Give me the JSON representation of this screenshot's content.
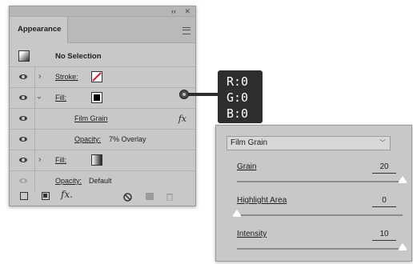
{
  "appearance": {
    "tab_label": "Appearance",
    "rows": {
      "header": {
        "label": "No Selection"
      },
      "stroke": {
        "label": "Stroke:"
      },
      "fill": {
        "label": "Fill:"
      },
      "effect": {
        "label": "Film Grain"
      },
      "effect_opacity": {
        "label": "Opacity:",
        "value": "7% Overlay"
      },
      "fill2": {
        "label": "Fill:"
      },
      "opacity": {
        "label": "Opacity:",
        "value": "Default"
      }
    }
  },
  "color_readout": {
    "r": "R:0",
    "g": "G:0",
    "b": "B:0"
  },
  "film_grain": {
    "effect_select": "Film Grain",
    "params": [
      {
        "label": "Grain",
        "value": "20",
        "fraction": 1.0
      },
      {
        "label": "Highlight Area",
        "value": "0",
        "fraction": 0.0
      },
      {
        "label": "Intensity",
        "value": "10",
        "fraction": 1.0
      }
    ]
  },
  "icons": [
    "collapse-icon",
    "close-icon",
    "panel-menu-icon",
    "eye-icon",
    "expand-arrow-icon",
    "collapse-arrow-icon",
    "fx-icon",
    "add-stroke-icon",
    "add-fill-icon",
    "add-effect-icon",
    "clear-icon",
    "duplicate-icon",
    "delete-icon",
    "chevron-down-icon"
  ]
}
